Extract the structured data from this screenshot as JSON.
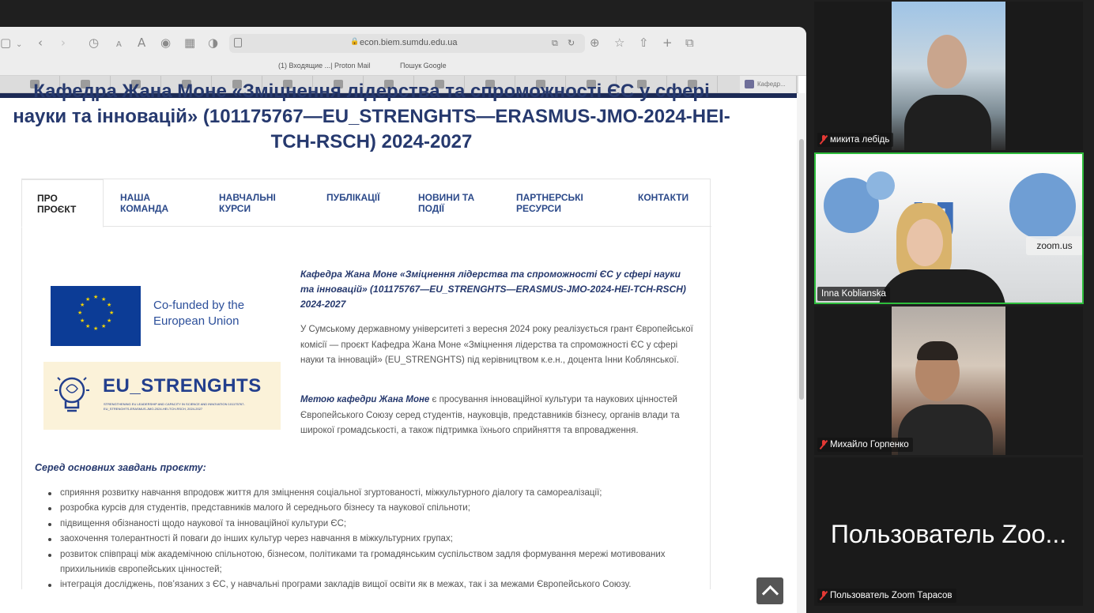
{
  "browser": {
    "url": "econ.biem.sumdu.edu.ua",
    "bookmarks": [
      "(1) Входящие ...| Proton Mail",
      "Пошук Google"
    ],
    "active_tab_label": "Кафедр..."
  },
  "page": {
    "title": "Кафедра Жана Моне «Зміцнення лідерства та спроможності ЄС у сфері науки та інновацій» (101175767—EU_STRENGHTS—ERASMUS-JMO-2024-HEI-TCH-RSCH) 2024-2027",
    "tabs": [
      "ПРО ПРОЄКТ",
      "НАША КОМАНДА",
      "НАВЧАЛЬНІ КУРСИ",
      "ПУБЛІКАЦІЇ",
      "НОВИНИ ТА ПОДІЇ",
      "ПАРТНЕРСЬКІ РЕСУРСИ",
      "КОНТАКТИ"
    ],
    "cofunded_text": "Co-funded by the European Union",
    "logo_text": "EU_STRENGHTS",
    "logo_subtext": "STRENGTHENING EU LEADERSHIP AND CAPACITY IN SCIENCE AND INNOVATION 101175767-EU_STRENGHTS-ERASMUS-JMO-2024-HEI-TCH-RSCH, 2024-2027",
    "intro_title": "Кафедра Жана Моне «Зміцнення лідерства та спроможності ЄС у сфері науки та інновацій» (101175767—EU_STRENGHTS—ERASMUS-JMO-2024-HEI-TCH-RSCH) 2024-2027",
    "intro_para": "У Сумському державному університеті з вересня 2024 року реалізується грант Європейської комісії — проєкт Кафедра Жана Моне «Зміцнення лідерства та спроможності ЄС у сфері науки та інновацій» (EU_STRENGHTS) під керівництвом к.е.н., доцента Інни Коблянської.",
    "goal_bold": "Метою кафедри Жана Моне",
    "goal_text": " є просування інноваційної культури та наукових цінностей Європейського Союзу серед студентів, науковців, представників бізнесу, органів влади та широкої громадськості, а також підтримка їхнього сприйняття та впровадження.",
    "tasks_heading": "Серед основних завдань проєкту:",
    "tasks": [
      "сприяння розвитку навчання впродовж життя для зміцнення соціальної згуртованості, міжкультурного діалогу та самореалізації;",
      "розробка курсів для студентів, представників малого й середнього бізнесу та наукової спільноти;",
      "підвищення обізнаності щодо наукової та інноваційної культури ЄС;",
      "заохочення толерантності й поваги до інших культур через навчання в міжкультурних групах;",
      "розвиток співпраці між академічною спільнотою, бізнесом, політиками та громадянським суспільством задля формування мережі мотивованих прихильників європейських цінностей;",
      "інтеграція досліджень, пов’язаних з ЄС, у навчальні програми закладів вищої освіти як в межах, так і за межами Європейського Союзу."
    ]
  },
  "zoom": {
    "participants": [
      {
        "name": "микита лебідь",
        "muted": true
      },
      {
        "name": "Inna Koblianska",
        "muted": false,
        "watermark": "zoom.us"
      },
      {
        "name": "Михайло Горпенко",
        "muted": true
      },
      {
        "name": "Пользователь Zoom Тарасов",
        "muted": true,
        "display_name": "Пользователь Zoo..."
      }
    ],
    "speaker_highlight_color": "#2ebd3c"
  }
}
